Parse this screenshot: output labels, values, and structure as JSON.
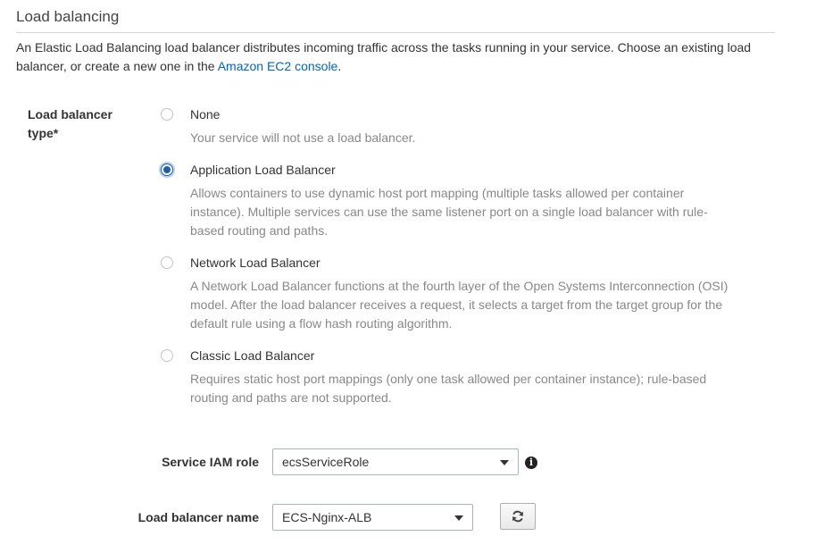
{
  "section": {
    "title": "Load balancing",
    "intro_text": "An Elastic Load Balancing load balancer distributes incoming traffic across the tasks running in your service. Choose an existing load balancer, or create a new one in the ",
    "intro_link": "Amazon EC2 console",
    "intro_end": "."
  },
  "lb_type": {
    "label": "Load balancer type*",
    "selected": "Application Load Balancer",
    "options": [
      {
        "label": "None",
        "description": "Your service will not use a load balancer.",
        "checked": false
      },
      {
        "label": "Application Load Balancer",
        "description": "Allows containers to use dynamic host port mapping (multiple tasks allowed per container instance). Multiple services can use the same listener port on a single load balancer with rule-based routing and paths.",
        "checked": true
      },
      {
        "label": "Network Load Balancer",
        "description": "A Network Load Balancer functions at the fourth layer of the Open Systems Interconnection (OSI) model. After the load balancer receives a request, it selects a target from the target group for the default rule using a flow hash routing algorithm.",
        "checked": false
      },
      {
        "label": "Classic Load Balancer",
        "description": "Requires static host port mappings (only one task allowed per container instance); rule-based routing and paths are not supported.",
        "checked": false
      }
    ]
  },
  "iam_role": {
    "label": "Service IAM role",
    "value": "ecsServiceRole",
    "info_glyph": "i",
    "icon": "info-icon"
  },
  "lb_name": {
    "label": "Load balancer name",
    "value": "ECS-Nginx-ALB",
    "refresh_icon": "refresh-icon"
  },
  "colors": {
    "link": "#0066c0",
    "radio_selected": "#1f5fae",
    "description_text": "#888888"
  }
}
